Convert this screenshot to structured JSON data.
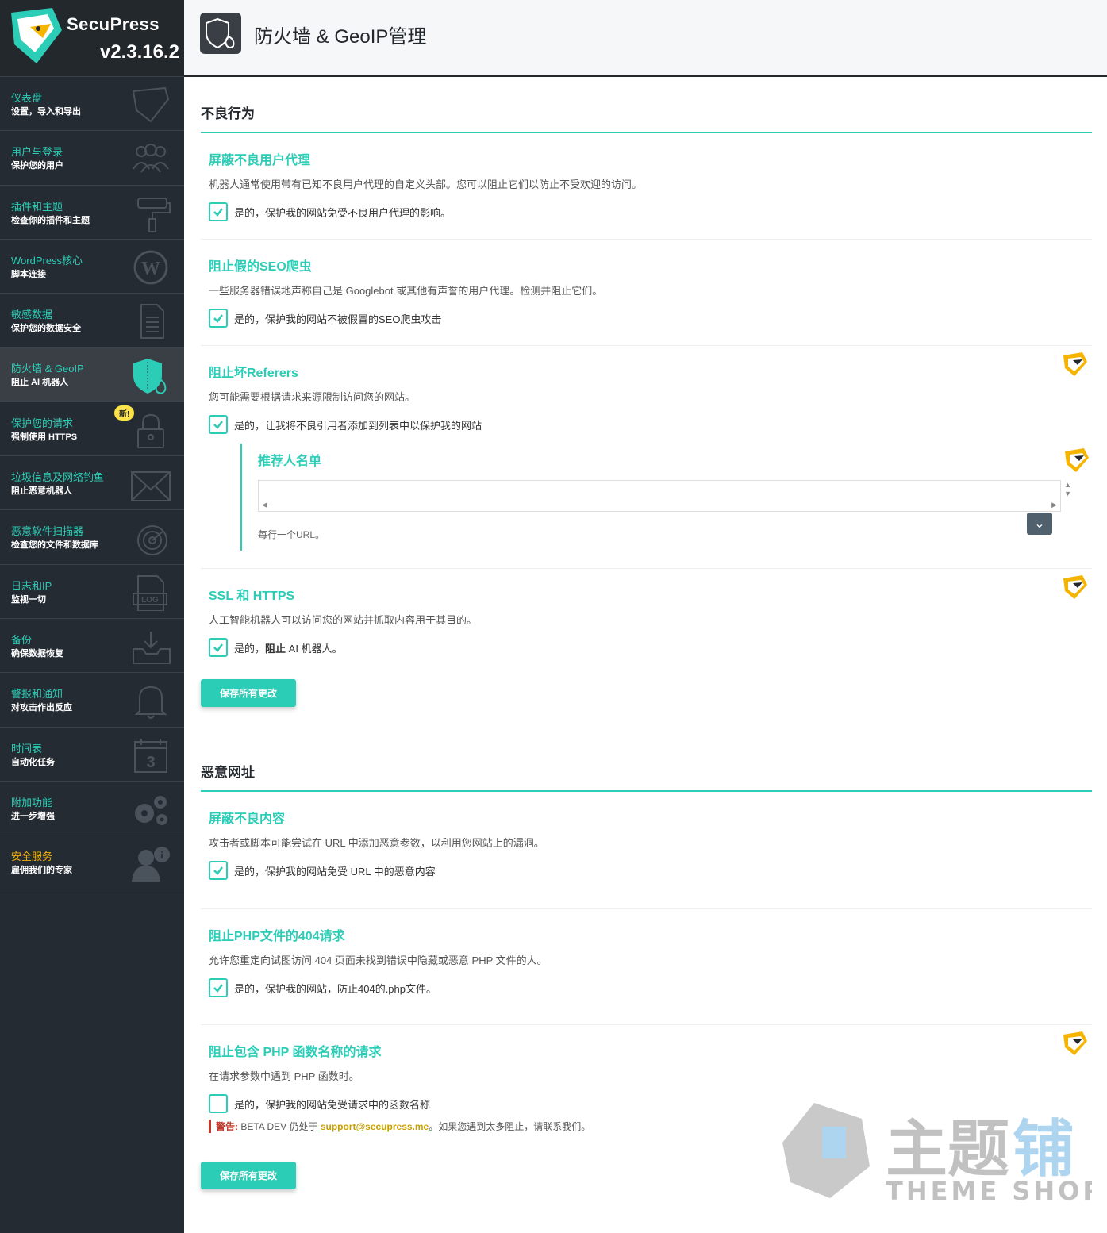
{
  "brand": {
    "name": "SecuPress",
    "version": "v2.3.16.2"
  },
  "nav": [
    {
      "title": "仪表盘",
      "sub": "设置，导入和导出",
      "icon": "secupress-logo-icon"
    },
    {
      "title": "用户与登录",
      "sub": "保护您的用户",
      "icon": "users-icon"
    },
    {
      "title": "插件和主题",
      "sub": "检查你的插件和主题",
      "icon": "paint-roller-icon"
    },
    {
      "title": "WordPress核心",
      "sub": "脚本连接",
      "icon": "wordpress-icon"
    },
    {
      "title": "敏感数据",
      "sub": "保护您的数据安全",
      "icon": "document-icon"
    },
    {
      "title": "防火墙 & GeoIP",
      "sub": "阻止 AI 机器人",
      "icon": "firewall-shield-icon"
    },
    {
      "title": "保护您的请求",
      "sub": "强制使用 HTTPS",
      "icon": "lock-icon",
      "badge": "新!"
    },
    {
      "title": "垃圾信息及网络钓鱼",
      "sub": "阻止恶意机器人",
      "icon": "envelope-icon"
    },
    {
      "title": "恶意软件扫描器",
      "sub": "检查您的文件和数据库",
      "icon": "radar-icon"
    },
    {
      "title": "日志和IP",
      "sub": "监视一切",
      "icon": "log-icon"
    },
    {
      "title": "备份",
      "sub": "确保数据恢复",
      "icon": "inbox-download-icon"
    },
    {
      "title": "警报和通知",
      "sub": "对攻击作出反应",
      "icon": "bell-icon"
    },
    {
      "title": "时间表",
      "sub": "自动化任务",
      "icon": "calendar-icon"
    },
    {
      "title": "附加功能",
      "sub": "进一步增强",
      "icon": "gears-icon"
    },
    {
      "title": "安全服务",
      "sub": "雇佣我们的专家",
      "icon": "expert-icon"
    }
  ],
  "header": {
    "title": "防火墙 & GeoIP管理"
  },
  "sections": [
    {
      "title": "不良行为",
      "blocks": [
        {
          "title": "屏蔽不良用户代理",
          "desc": "机器人通常使用带有已知不良用户代理的自定义头部。您可以阻止它们以防止不受欢迎的访问。",
          "check": "是的，保护我的网站免受不良用户代理的影响。",
          "checked": true
        },
        {
          "title": "阻止假的SEO爬虫",
          "desc": "一些服务器错误地声称自己是 Googlebot 或其他有声誉的用户代理。检测并阻止它们。",
          "check": "是的，保护我的网站不被假冒的SEO爬虫攻击",
          "checked": true
        },
        {
          "title": "阻止坏Referers",
          "desc": "您可能需要根据请求来源限制访问您的网站。",
          "check": "是的，让我将不良引用者添加到列表中以保护我的网站",
          "checked": true,
          "pro": true,
          "sub": {
            "title": "推荐人名单",
            "hint": "每行一个URL。"
          }
        },
        {
          "title": "SSL 和 HTTPS",
          "desc": "人工智能机器人可以访问您的网站并抓取内容用于其目的。",
          "check_pre": "是的，",
          "check_bold": "阻止",
          "check_post": " AI 机器人。",
          "checked": true,
          "pro": true
        }
      ],
      "save": "保存所有更改"
    },
    {
      "title": "恶意网址",
      "blocks": [
        {
          "title": "屏蔽不良内容",
          "desc": "攻击者或脚本可能尝试在 URL 中添加恶意参数，以利用您网站上的漏洞。",
          "check": "是的，保护我的网站免受 URL 中的恶意内容",
          "checked": true
        },
        {
          "title": "阻止PHP文件的404请求",
          "desc": "允许您重定向试图访问 404 页面未找到错误中隐藏或恶意 PHP 文件的人。",
          "check": "是的，保护我的网站，防止404的.php文件。",
          "checked": true
        },
        {
          "title": "阻止包含 PHP 函数名称的请求",
          "desc": "在请求参数中遇到 PHP 函数时。",
          "check": "是的，保护我的网站免受请求中的函数名称",
          "checked": false,
          "pro": true,
          "warn": {
            "label": "警告:",
            "pre": " BETA DEV 仍处于 ",
            "link": "support@secupress.me",
            "post": "。如果您遇到太多阻止，请联系我们。"
          }
        }
      ],
      "save": "保存所有更改"
    }
  ],
  "watermark": {
    "main": "主题铺",
    "sub": "THEME SHOP"
  },
  "colors": {
    "accent": "#2bcdb6",
    "sidebar": "#252b33",
    "badge": "#fde34a",
    "warn": "#c0392b"
  }
}
